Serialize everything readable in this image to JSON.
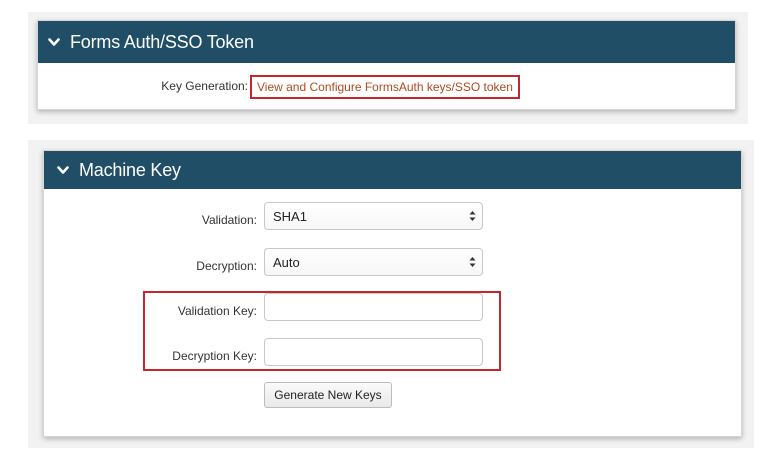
{
  "forms_auth_panel": {
    "title": "Forms Auth/SSO Token",
    "key_generation_label": "Key Generation:",
    "key_generation_link": "View and Configure FormsAuth keys/SSO token"
  },
  "machine_key_panel": {
    "title": "Machine Key",
    "validation_label": "Validation:",
    "validation_value": "SHA1",
    "decryption_label": "Decryption:",
    "decryption_value": "Auto",
    "validation_key_label": "Validation Key:",
    "validation_key_value": "",
    "decryption_key_label": "Decryption Key:",
    "decryption_key_value": "",
    "generate_button": "Generate New Keys"
  },
  "colors": {
    "header_bg": "#1f4e66",
    "highlight": "#c1272d",
    "link": "#b04a1f"
  }
}
